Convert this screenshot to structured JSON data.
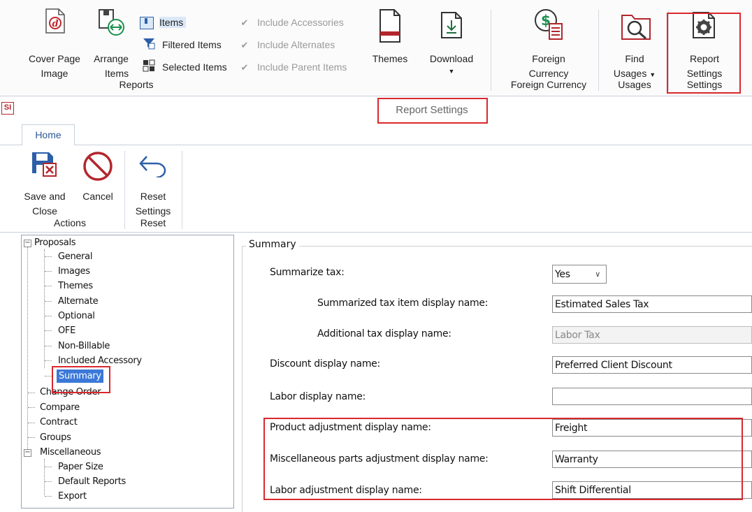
{
  "top_ribbon": {
    "reports_group": {
      "cover_page": "Cover Page\nImage",
      "cover_page_l1": "Cover Page",
      "cover_page_l2": "Image",
      "arrange_l1": "Arrange",
      "arrange_l2": "Items",
      "items": "Items",
      "filtered_items": "Filtered Items",
      "selected_items": "Selected Items",
      "group_label": "Reports"
    },
    "checkboxes": [
      {
        "label": "Include Accessories",
        "checked": true
      },
      {
        "label": "Include Alternates",
        "checked": true
      },
      {
        "label": "Include Parent Items",
        "checked": true
      }
    ],
    "themes": "Themes",
    "download": "Download",
    "foreign_l1": "Foreign",
    "foreign_l2": "Currency",
    "foreign_group": "Foreign Currency",
    "find_l1": "Find",
    "find_l2": "Usages",
    "usages_group": "Usages",
    "report_l1": "Report",
    "report_l2": "Settings",
    "settings_group": "Settings"
  },
  "window": {
    "app_badge": "SI",
    "title": "Report Settings",
    "tab_home": "Home",
    "actions": {
      "save_l1": "Save and",
      "save_l2": "Close",
      "cancel": "Cancel",
      "group": "Actions"
    },
    "reset": {
      "l1": "Reset",
      "l2": "Settings",
      "group": "Reset"
    }
  },
  "tree": {
    "proposals": "Proposals",
    "proposal_children": [
      "General",
      "Images",
      "Themes",
      "Alternate",
      "Optional",
      "OFE",
      "Non-Billable",
      "Included Accessory",
      "Summary"
    ],
    "change_order": "Change Order",
    "compare": "Compare",
    "contract": "Contract",
    "groups": "Groups",
    "misc": "Miscellaneous",
    "misc_children": [
      "Paper Size",
      "Default Reports",
      "Export"
    ]
  },
  "panel": {
    "group_title": "Summary",
    "summarize_tax_label": "Summarize tax:",
    "summarize_tax_value": "Yes",
    "summarized_tax_name_label": "Summarized tax item display name:",
    "summarized_tax_name_value": "Estimated Sales Tax",
    "additional_tax_label": "Additional tax display name:",
    "additional_tax_value": "Labor Tax",
    "discount_label": "Discount display name:",
    "discount_value": "Preferred Client Discount",
    "labor_label": "Labor display name:",
    "labor_value": "",
    "product_adj_label": "Product adjustment display name:",
    "product_adj_value": "Freight",
    "misc_adj_label": "Miscellaneous parts adjustment display name:",
    "misc_adj_value": "Warranty",
    "labor_adj_label": "Labor adjustment display name:",
    "labor_adj_value": "Shift Differential"
  },
  "colors": {
    "highlight_red": "#d9282e",
    "selection_blue": "#3b78d8",
    "accent_blue": "#2b5797"
  }
}
